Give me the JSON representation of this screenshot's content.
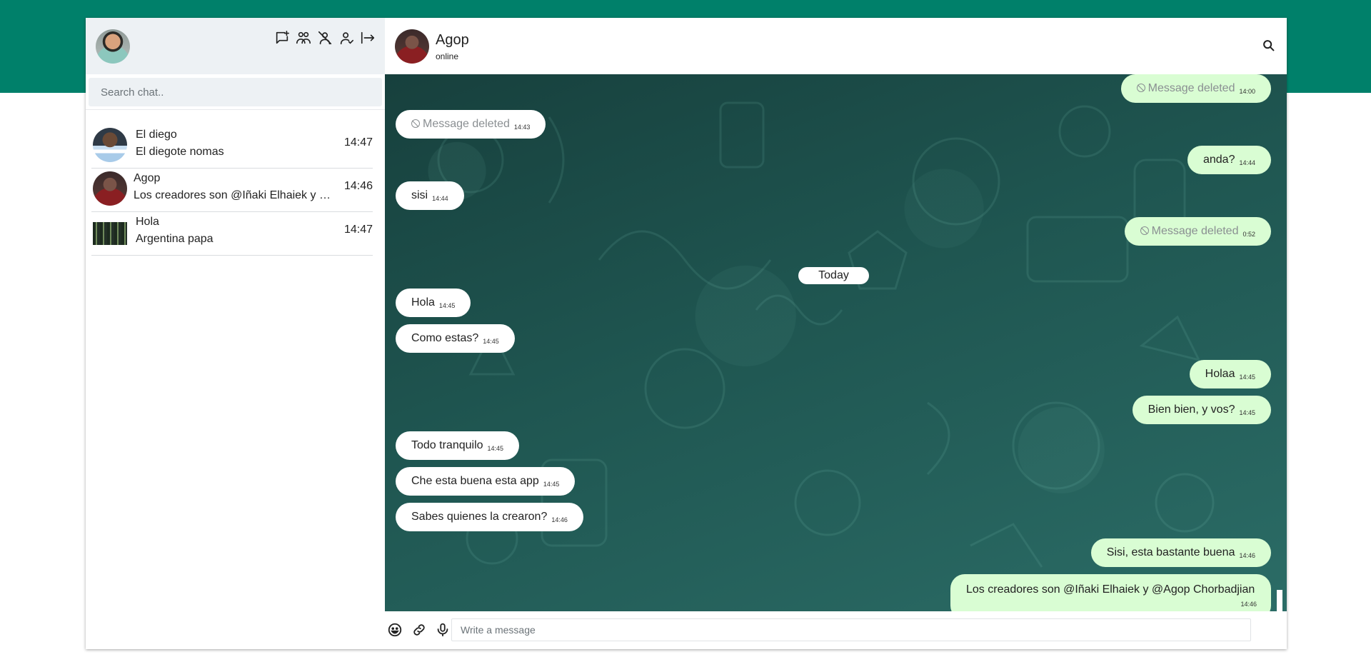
{
  "colors": {
    "band": "#00806a",
    "outgoing_bubble": "#d9fdd3",
    "incoming_bubble": "#ffffff",
    "sidebar_header": "#edf1f4"
  },
  "sidebar": {
    "icons": [
      "new-chat-icon",
      "new-group-icon",
      "blocked-users-icon",
      "profile-icon",
      "logout-icon"
    ],
    "search_placeholder": "Search chat..",
    "chats": [
      {
        "name": "El diego",
        "preview": "El diegote nomas",
        "time": "14:47"
      },
      {
        "name": "Agop",
        "preview": "Los creadores son @Iñaki Elhaiek y @Agop Chorbadjian",
        "time": "14:46"
      },
      {
        "name": "Hola",
        "preview": "Argentina papa",
        "time": "14:47"
      }
    ]
  },
  "chat": {
    "title": "Agop",
    "status": "online",
    "day_separator": "Today",
    "messages": [
      {
        "dir": "out",
        "deleted": true,
        "text": "Message deleted",
        "time": "14:00"
      },
      {
        "dir": "in",
        "deleted": true,
        "text": "Message deleted",
        "time": "14:43"
      },
      {
        "dir": "out",
        "text": "anda?",
        "time": "14:44"
      },
      {
        "dir": "in",
        "text": "sisi",
        "time": "14:44"
      },
      {
        "dir": "out",
        "deleted": true,
        "text": "Message deleted",
        "time": "0:52"
      },
      {
        "dir": "in",
        "text": "Hola",
        "time": "14:45"
      },
      {
        "dir": "in",
        "text": "Como estas?",
        "time": "14:45"
      },
      {
        "dir": "out",
        "text": "Holaa",
        "time": "14:45"
      },
      {
        "dir": "out",
        "text": "Bien bien, y vos?",
        "time": "14:45"
      },
      {
        "dir": "in",
        "text": "Todo tranquilo",
        "time": "14:45"
      },
      {
        "dir": "in",
        "text": "Che esta buena esta app",
        "time": "14:45"
      },
      {
        "dir": "in",
        "text": "Sabes quienes la crearon?",
        "time": "14:46"
      },
      {
        "dir": "out",
        "text": "Sisi, esta bastante buena",
        "time": "14:46"
      },
      {
        "dir": "out",
        "text": "Los creadores son @Iñaki Elhaiek y @Agop Chorbadjian",
        "time": "14:46"
      }
    ]
  },
  "composer": {
    "icons": [
      "emoji-icon",
      "attach-link-icon",
      "microphone-icon"
    ],
    "placeholder": "Write a message"
  }
}
